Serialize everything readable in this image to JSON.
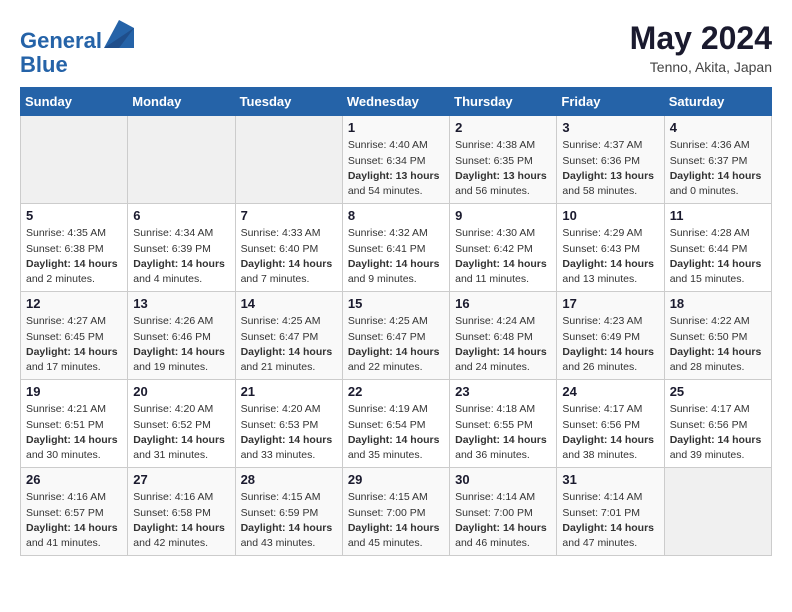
{
  "header": {
    "logo_line1": "General",
    "logo_line2": "Blue",
    "month": "May 2024",
    "location": "Tenno, Akita, Japan"
  },
  "days_of_week": [
    "Sunday",
    "Monday",
    "Tuesday",
    "Wednesday",
    "Thursday",
    "Friday",
    "Saturday"
  ],
  "weeks": [
    [
      {
        "day": "",
        "info": ""
      },
      {
        "day": "",
        "info": ""
      },
      {
        "day": "",
        "info": ""
      },
      {
        "day": "1",
        "info": "Sunrise: 4:40 AM\nSunset: 6:34 PM\nDaylight: 13 hours\nand 54 minutes."
      },
      {
        "day": "2",
        "info": "Sunrise: 4:38 AM\nSunset: 6:35 PM\nDaylight: 13 hours\nand 56 minutes."
      },
      {
        "day": "3",
        "info": "Sunrise: 4:37 AM\nSunset: 6:36 PM\nDaylight: 13 hours\nand 58 minutes."
      },
      {
        "day": "4",
        "info": "Sunrise: 4:36 AM\nSunset: 6:37 PM\nDaylight: 14 hours\nand 0 minutes."
      }
    ],
    [
      {
        "day": "5",
        "info": "Sunrise: 4:35 AM\nSunset: 6:38 PM\nDaylight: 14 hours\nand 2 minutes."
      },
      {
        "day": "6",
        "info": "Sunrise: 4:34 AM\nSunset: 6:39 PM\nDaylight: 14 hours\nand 4 minutes."
      },
      {
        "day": "7",
        "info": "Sunrise: 4:33 AM\nSunset: 6:40 PM\nDaylight: 14 hours\nand 7 minutes."
      },
      {
        "day": "8",
        "info": "Sunrise: 4:32 AM\nSunset: 6:41 PM\nDaylight: 14 hours\nand 9 minutes."
      },
      {
        "day": "9",
        "info": "Sunrise: 4:30 AM\nSunset: 6:42 PM\nDaylight: 14 hours\nand 11 minutes."
      },
      {
        "day": "10",
        "info": "Sunrise: 4:29 AM\nSunset: 6:43 PM\nDaylight: 14 hours\nand 13 minutes."
      },
      {
        "day": "11",
        "info": "Sunrise: 4:28 AM\nSunset: 6:44 PM\nDaylight: 14 hours\nand 15 minutes."
      }
    ],
    [
      {
        "day": "12",
        "info": "Sunrise: 4:27 AM\nSunset: 6:45 PM\nDaylight: 14 hours\nand 17 minutes."
      },
      {
        "day": "13",
        "info": "Sunrise: 4:26 AM\nSunset: 6:46 PM\nDaylight: 14 hours\nand 19 minutes."
      },
      {
        "day": "14",
        "info": "Sunrise: 4:25 AM\nSunset: 6:47 PM\nDaylight: 14 hours\nand 21 minutes."
      },
      {
        "day": "15",
        "info": "Sunrise: 4:25 AM\nSunset: 6:47 PM\nDaylight: 14 hours\nand 22 minutes."
      },
      {
        "day": "16",
        "info": "Sunrise: 4:24 AM\nSunset: 6:48 PM\nDaylight: 14 hours\nand 24 minutes."
      },
      {
        "day": "17",
        "info": "Sunrise: 4:23 AM\nSunset: 6:49 PM\nDaylight: 14 hours\nand 26 minutes."
      },
      {
        "day": "18",
        "info": "Sunrise: 4:22 AM\nSunset: 6:50 PM\nDaylight: 14 hours\nand 28 minutes."
      }
    ],
    [
      {
        "day": "19",
        "info": "Sunrise: 4:21 AM\nSunset: 6:51 PM\nDaylight: 14 hours\nand 30 minutes."
      },
      {
        "day": "20",
        "info": "Sunrise: 4:20 AM\nSunset: 6:52 PM\nDaylight: 14 hours\nand 31 minutes."
      },
      {
        "day": "21",
        "info": "Sunrise: 4:20 AM\nSunset: 6:53 PM\nDaylight: 14 hours\nand 33 minutes."
      },
      {
        "day": "22",
        "info": "Sunrise: 4:19 AM\nSunset: 6:54 PM\nDaylight: 14 hours\nand 35 minutes."
      },
      {
        "day": "23",
        "info": "Sunrise: 4:18 AM\nSunset: 6:55 PM\nDaylight: 14 hours\nand 36 minutes."
      },
      {
        "day": "24",
        "info": "Sunrise: 4:17 AM\nSunset: 6:56 PM\nDaylight: 14 hours\nand 38 minutes."
      },
      {
        "day": "25",
        "info": "Sunrise: 4:17 AM\nSunset: 6:56 PM\nDaylight: 14 hours\nand 39 minutes."
      }
    ],
    [
      {
        "day": "26",
        "info": "Sunrise: 4:16 AM\nSunset: 6:57 PM\nDaylight: 14 hours\nand 41 minutes."
      },
      {
        "day": "27",
        "info": "Sunrise: 4:16 AM\nSunset: 6:58 PM\nDaylight: 14 hours\nand 42 minutes."
      },
      {
        "day": "28",
        "info": "Sunrise: 4:15 AM\nSunset: 6:59 PM\nDaylight: 14 hours\nand 43 minutes."
      },
      {
        "day": "29",
        "info": "Sunrise: 4:15 AM\nSunset: 7:00 PM\nDaylight: 14 hours\nand 45 minutes."
      },
      {
        "day": "30",
        "info": "Sunrise: 4:14 AM\nSunset: 7:00 PM\nDaylight: 14 hours\nand 46 minutes."
      },
      {
        "day": "31",
        "info": "Sunrise: 4:14 AM\nSunset: 7:01 PM\nDaylight: 14 hours\nand 47 minutes."
      },
      {
        "day": "",
        "info": ""
      }
    ]
  ]
}
